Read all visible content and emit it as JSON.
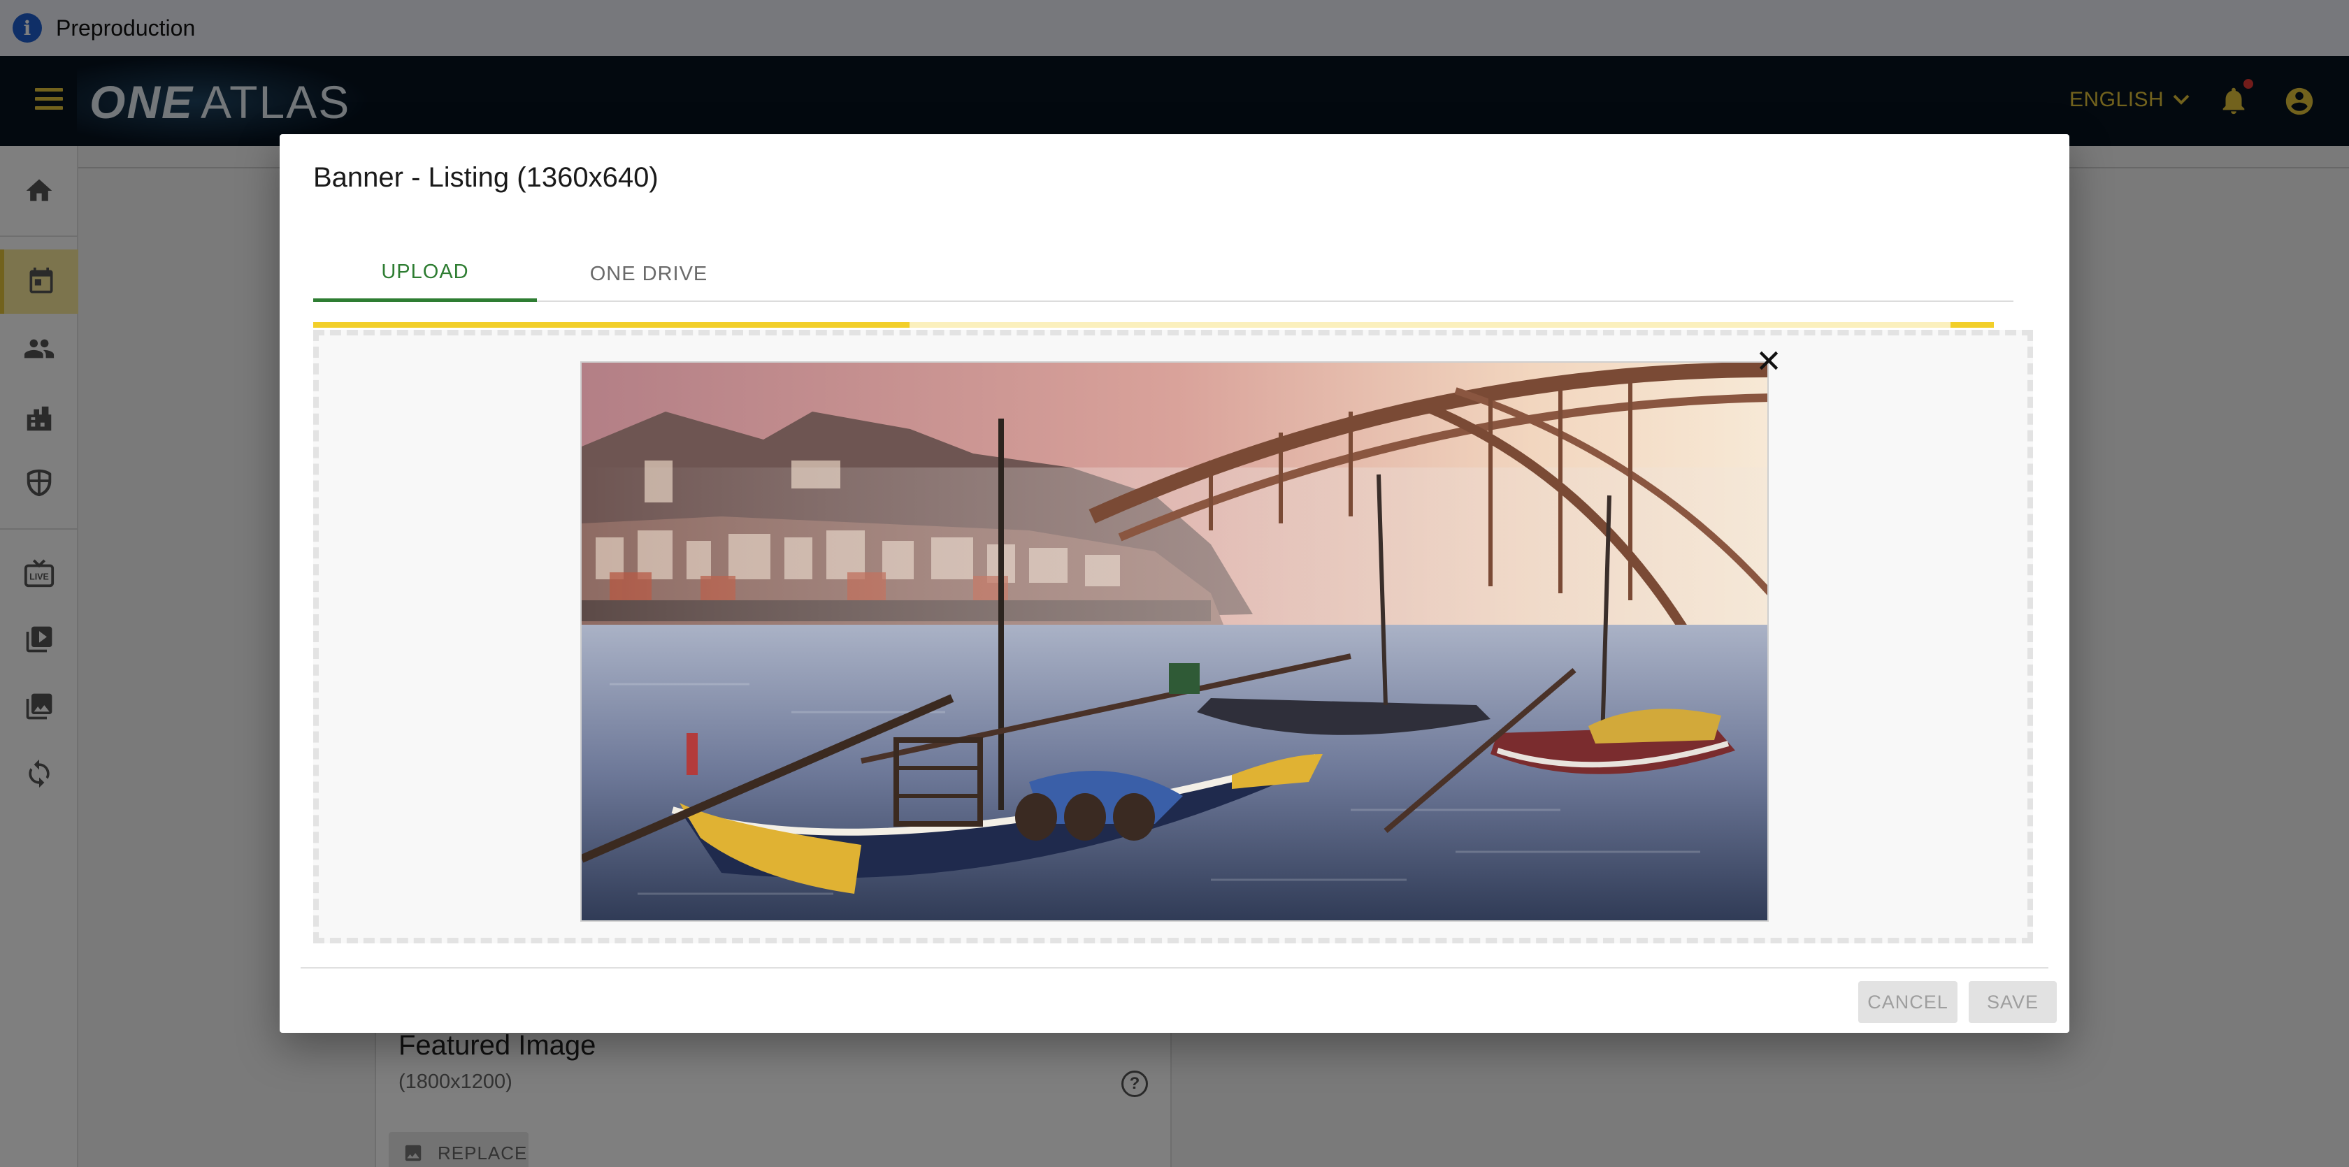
{
  "env_banner": {
    "text": "Preproduction"
  },
  "header": {
    "logo_one": "ONE",
    "logo_atlas": "ATLAS",
    "language": "ENGLISH",
    "brand_color": "#e4c53a",
    "notification_badge_color": "#e53935"
  },
  "sidebar": {
    "items": [
      {
        "icon": "home-icon",
        "active": false
      },
      {
        "icon": "calendar-icon",
        "active": true
      },
      {
        "icon": "people-icon",
        "active": false
      },
      {
        "icon": "building-icon",
        "active": false
      },
      {
        "icon": "shield-icon",
        "active": false
      },
      {
        "icon": "live-tv-icon",
        "active": false
      },
      {
        "icon": "video-library-icon",
        "active": false
      },
      {
        "icon": "collections-icon",
        "active": false
      },
      {
        "icon": "sync-icon",
        "active": false
      }
    ]
  },
  "background_card": {
    "title": "Featured Image",
    "subtitle": "(1800x1200)",
    "replace_label": "REPLACE"
  },
  "dialog": {
    "title": "Banner - Listing (1360x640)",
    "tabs": [
      {
        "label": "UPLOAD",
        "active": true
      },
      {
        "label": "ONE DRIVE",
        "active": false
      }
    ],
    "upload_progress": 0.355,
    "accent_color": "#2e7d32",
    "progress_color": "#f2cf2a",
    "cancel_label": "CANCEL",
    "save_label": "SAVE"
  }
}
